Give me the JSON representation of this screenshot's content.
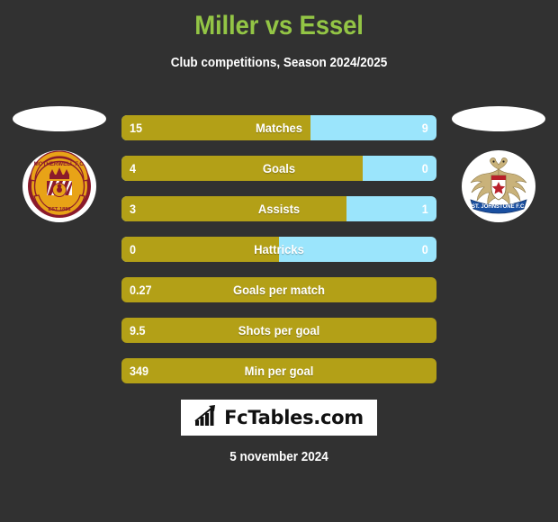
{
  "header": {
    "title": "Miller vs Essel",
    "subtitle": "Club competitions, Season 2024/2025",
    "title_color": "#93c545",
    "subtitle_color": "#ffffff"
  },
  "background_color": "#313131",
  "colors": {
    "home_bar": "#b3a017",
    "away_bar": "#9be5fc",
    "value_text": "#ffffff"
  },
  "teams": {
    "home": {
      "crest_name": "motherwell-fc-crest",
      "crest_top_text": "MOTHERWELL F.C.",
      "crest_bottom_text": "EST 1886",
      "crest_colors": [
        "#e8a317",
        "#8b1a2b",
        "#ffffff"
      ]
    },
    "away": {
      "crest_name": "st-johnstone-fc-crest",
      "crest_banner_text": "ST. JOHNSTONE F.C.",
      "crest_colors": [
        "#1a4fa0",
        "#c9b27a",
        "#ffffff",
        "#b81f2a"
      ]
    }
  },
  "stats": [
    {
      "label": "Matches",
      "home": "15",
      "away": "9",
      "home_pct": 60,
      "split": true
    },
    {
      "label": "Goals",
      "home": "4",
      "away": "0",
      "home_pct": 76.5,
      "split": true
    },
    {
      "label": "Assists",
      "home": "3",
      "away": "1",
      "home_pct": 71.5,
      "split": true
    },
    {
      "label": "Hattricks",
      "home": "0",
      "away": "0",
      "home_pct": 50,
      "split": true
    },
    {
      "label": "Goals per match",
      "home": "0.27",
      "away": "",
      "home_pct": 100,
      "split": false
    },
    {
      "label": "Shots per goal",
      "home": "9.5",
      "away": "",
      "home_pct": 100,
      "split": false
    },
    {
      "label": "Min per goal",
      "home": "349",
      "away": "",
      "home_pct": 100,
      "split": false
    }
  ],
  "footer": {
    "logo_text": "FcTables.com",
    "logo_icon": "bar-chart-growth-icon",
    "date": "5 november 2024"
  }
}
